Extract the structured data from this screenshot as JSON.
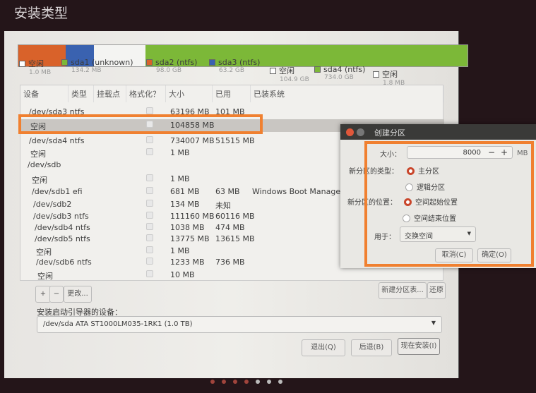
{
  "title": "安装类型",
  "partition_bar": [
    {
      "color": "#d9622a",
      "share": 0.106
    },
    {
      "color": "#3a62b0",
      "share": 0.063
    },
    {
      "color": "#f4f4f2",
      "share": 0.114
    },
    {
      "color": "#7cb838",
      "share": 0.717
    }
  ],
  "legend": [
    {
      "label": "空闲",
      "size": "1.0 MB",
      "color": "#ffffff"
    },
    {
      "label": "sda1 (unknown)",
      "size": "134.2 MB",
      "color": "#7cb838"
    },
    {
      "label": "sda2 (ntfs)",
      "size": "98.0 GB",
      "color": "#d9622a"
    },
    {
      "label": "sda3 (ntfs)",
      "size": "63.2 GB",
      "color": "#3a62b0"
    },
    {
      "label": "空闲",
      "size": "104.9 GB",
      "color": "#ffffff"
    },
    {
      "label": "sda4 (ntfs)",
      "size": "734.0 GB",
      "color": "#7cb838"
    },
    {
      "label": "空闲",
      "size": "1.8 MB",
      "color": "#ffffff"
    }
  ],
  "table": {
    "headers": [
      "设备",
      "类型",
      "挂载点",
      "格式化？",
      "大小",
      "已用",
      "已装系统"
    ],
    "rows": [
      {
        "device": "/dev/sda3  ntfs",
        "size": "63196 MB",
        "used": "101 MB",
        "system": ""
      },
      {
        "device": "空闲",
        "size": "104858 MB",
        "used": "",
        "system": "",
        "selected": true
      },
      {
        "device": "/dev/sda4  ntfs",
        "size": "734007 MB",
        "used": "51515 MB",
        "system": ""
      },
      {
        "device": "空闲",
        "size": "1 MB",
        "used": "",
        "system": ""
      },
      {
        "device": "/dev/sdb",
        "size": "",
        "used": "",
        "system": "",
        "disk": true
      },
      {
        "device": "空闲",
        "size": "1 MB",
        "used": "",
        "system": ""
      },
      {
        "device": "/dev/sdb1  efi",
        "size": "681 MB",
        "used": "63 MB",
        "system": "Windows Boot Manager"
      },
      {
        "device": "/dev/sdb2",
        "size": "134 MB",
        "used": "未知",
        "system": ""
      },
      {
        "device": "/dev/sdb3  ntfs",
        "size": "111160 MB",
        "used": "60116 MB",
        "system": ""
      },
      {
        "device": "/dev/sdb4  ntfs",
        "size": "1038 MB",
        "used": "474 MB",
        "system": ""
      },
      {
        "device": "/dev/sdb5  ntfs",
        "size": "13775 MB",
        "used": "13615 MB",
        "system": ""
      },
      {
        "device": "空闲",
        "size": "1 MB",
        "used": "",
        "system": ""
      },
      {
        "device": "/dev/sdb6  ntfs",
        "size": "1233 MB",
        "used": "736 MB",
        "system": ""
      },
      {
        "device": "空闲",
        "size": "10 MB",
        "used": "",
        "system": ""
      }
    ]
  },
  "actions": {
    "add": "+",
    "remove": "−",
    "change": "更改...",
    "new_table": "新建分区表...",
    "revert": "还原"
  },
  "bootloader": {
    "label": "安装启动引导器的设备：",
    "value": "/dev/sda    ATA ST1000LM035-1RK1 (1.0 TB)"
  },
  "buttons": {
    "quit": "退出(Q)",
    "back": "后退(B)",
    "install": "现在安装(I)"
  },
  "dialog": {
    "title": "创建分区",
    "size_label": "大小：",
    "size_value": "8000",
    "minus": "−",
    "plus": "+",
    "unit": "MB",
    "type_label": "新分区的类型：",
    "type_primary": "主分区",
    "type_logical": "逻辑分区",
    "location_label": "新分区的位置：",
    "loc_start": "空间起始位置",
    "loc_end": "空间结束位置",
    "use_label": "用于：",
    "use_value": "交换空间",
    "cancel": "取消(C)",
    "ok": "确定(O)"
  },
  "pager": {
    "total": 7,
    "current": 4
  }
}
